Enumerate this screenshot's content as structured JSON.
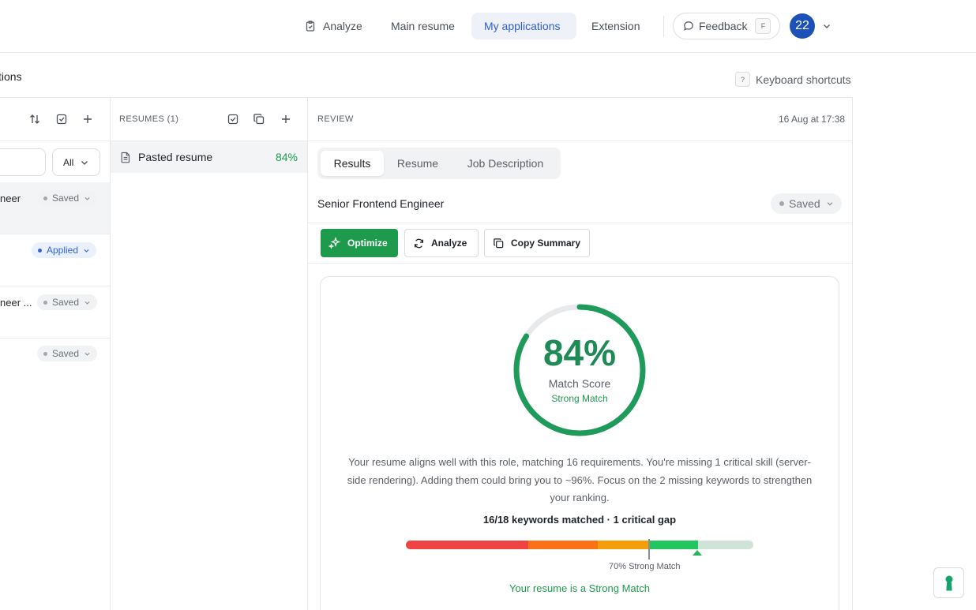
{
  "nav": {
    "items": [
      {
        "label": "Analyze",
        "icon": "clipboard-check-icon"
      },
      {
        "label": "Main resume"
      },
      {
        "label": "My applications",
        "active": true
      },
      {
        "label": "Extension"
      }
    ],
    "feedback_label": "Feedback",
    "feedback_key": "F",
    "avatar_text": "22"
  },
  "page": {
    "title": "tions",
    "shortcuts_key": "?",
    "shortcuts_label": "Keyboard shortcuts"
  },
  "applications": {
    "filter_value": "All",
    "rows": [
      {
        "title": "neer",
        "status": "Saved"
      },
      {
        "title": "",
        "status": "Applied"
      },
      {
        "title": "neer ...",
        "status": "Saved"
      },
      {
        "title": "",
        "status": "Saved"
      }
    ]
  },
  "resumes": {
    "header": "RESUMES (1)",
    "items": [
      {
        "name": "Pasted resume",
        "score": "84%"
      }
    ]
  },
  "review": {
    "header": "REVIEW",
    "date": "16 Aug at 17:38",
    "tabs": [
      "Results",
      "Resume",
      "Job Description"
    ],
    "job_title": "Senior Frontend Engineer",
    "status": "Saved",
    "buttons": {
      "optimize": "Optimize",
      "analyze": "Analyze",
      "copy": "Copy Summary"
    },
    "score": {
      "value": 84,
      "display": "84%",
      "label": "Match Score",
      "sublabel": "Strong Match"
    },
    "summary": "Your resume aligns well with this role, matching 16 requirements. You're missing 1 critical skill (server-side rendering). Adding them could bring you to ~96%. Focus on the 2 missing keywords to strengthen your ranking.",
    "keywords_line": "16/18 keywords matched · 1 critical gap",
    "threshold_label": "70% Strong Match",
    "threshold_value": 70,
    "verdict": "Your resume is a Strong Match"
  },
  "colors": {
    "accent_green": "#1e9a4c",
    "nav_active": "#2f5fd0",
    "bar_segments": [
      "#ef4444",
      "#f97316",
      "#f59e0b",
      "#22c55e",
      "#cfe3d8"
    ]
  }
}
